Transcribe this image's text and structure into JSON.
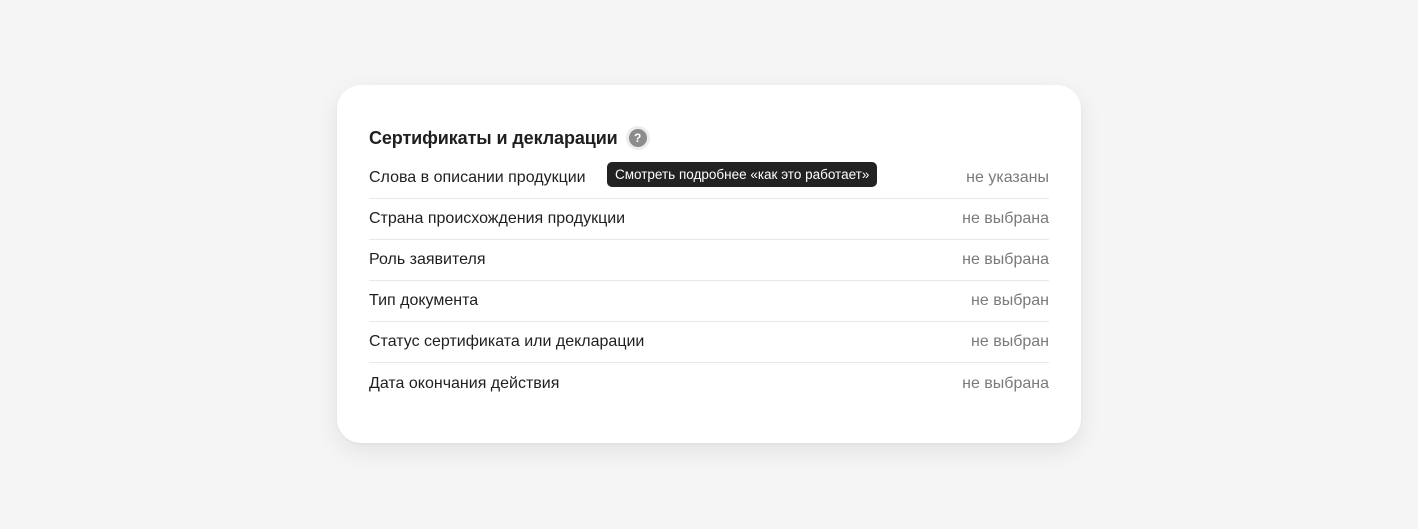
{
  "section": {
    "title": "Сертификаты и декларации",
    "help_icon": "question-mark-icon",
    "tooltip": "Смотреть подробнее «как это работает»"
  },
  "rows": [
    {
      "label": "Слова в описании продукции",
      "value": "не указаны"
    },
    {
      "label": "Страна происхождения продукции",
      "value": "не выбрана"
    },
    {
      "label": "Роль заявителя",
      "value": "не выбрана"
    },
    {
      "label": "Тип документа",
      "value": "не выбран"
    },
    {
      "label": "Статус сертификата или декларации",
      "value": "не выбран"
    },
    {
      "label": "Дата окончания действия",
      "value": "не выбрана"
    }
  ]
}
